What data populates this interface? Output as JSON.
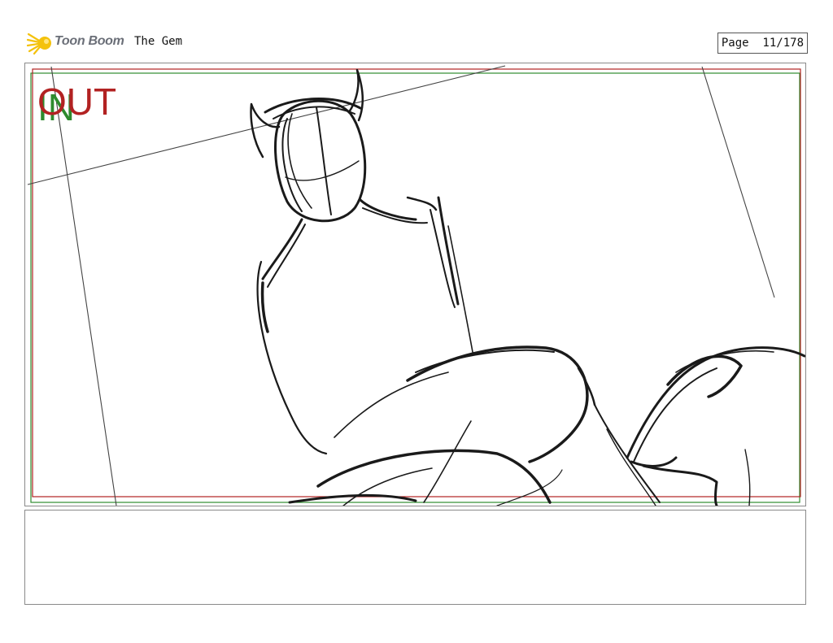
{
  "header": {
    "brand": "Toon Boom",
    "project_title": "The Gem",
    "page_label": "Page",
    "page_number": "11/178"
  },
  "panel": {
    "out_label": "OUT",
    "in_label": "IN"
  },
  "colors": {
    "safe_frame_red": "#b22222",
    "safe_frame_green": "#2e8b2e",
    "sketch_line": "#1a1a1a",
    "logo_yellow": "#f4c20d"
  },
  "notes": {
    "text": ""
  }
}
